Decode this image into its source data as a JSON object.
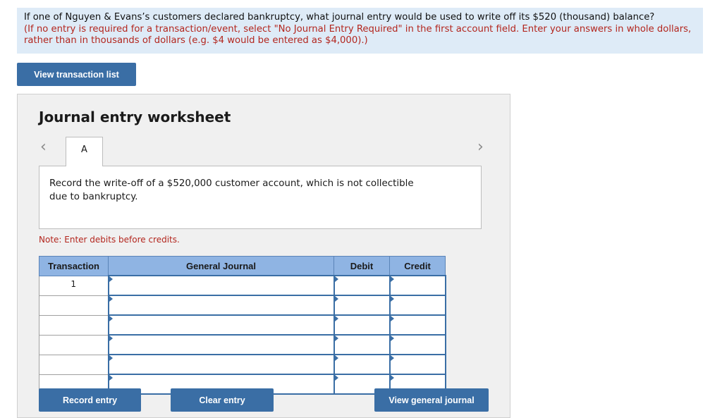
{
  "question": {
    "text": "If one of Nguyen & Evans’s customers declared bankruptcy, what journal entry would be used to write off its $520 (thousand) balance?",
    "instructions": "(If no entry is required for a transaction/event, select \"No Journal Entry Required\" in the first account field. Enter your answers in whole dollars, rather than in thousands of dollars (e.g. $4 would be entered as $4,000).)"
  },
  "buttons": {
    "view_transaction_list": "View transaction list",
    "record_entry": "Record entry",
    "clear_entry": "Clear entry",
    "view_general_journal": "View general journal"
  },
  "worksheet": {
    "title": "Journal entry worksheet",
    "prev_arrow": "‹",
    "next_arrow": "›",
    "active_tab": "A",
    "description": "Record the write-off of a $520,000 customer account, which is not collectible due to bankruptcy.",
    "note": "Note: Enter debits before credits."
  },
  "table": {
    "headers": {
      "transaction": "Transaction",
      "general_journal": "General Journal",
      "debit": "Debit",
      "credit": "Credit"
    },
    "rows": [
      {
        "transaction": "1",
        "account": "",
        "debit": "",
        "credit": ""
      },
      {
        "transaction": "",
        "account": "",
        "debit": "",
        "credit": ""
      },
      {
        "transaction": "",
        "account": "",
        "debit": "",
        "credit": ""
      },
      {
        "transaction": "",
        "account": "",
        "debit": "",
        "credit": ""
      },
      {
        "transaction": "",
        "account": "",
        "debit": "",
        "credit": ""
      },
      {
        "transaction": "",
        "account": "",
        "debit": "",
        "credit": ""
      }
    ]
  },
  "colors": {
    "accent": "#3a6ea5",
    "header_bg": "#8fb4e3",
    "question_bg": "#deebf7",
    "instruction_text": "#b3261e"
  }
}
